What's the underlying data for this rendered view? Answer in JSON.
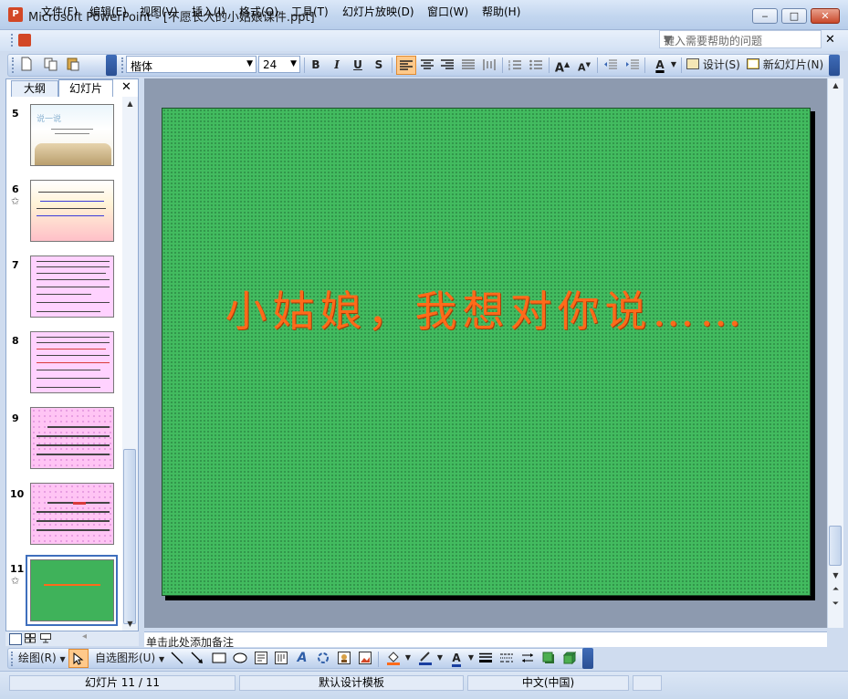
{
  "window": {
    "app_icon_text": "P",
    "title": "Microsoft PowerPoint - [不愿长大的小姑娘课件.ppt]",
    "controls": [
      "‒",
      "□",
      "✕"
    ]
  },
  "menu": {
    "items": [
      "文件(F)",
      "编辑(E)",
      "视图(V)",
      "插入(I)",
      "格式(O)",
      "工具(T)",
      "幻灯片放映(D)",
      "窗口(W)",
      "帮助(H)"
    ],
    "help_placeholder": "键入需要帮助的问题",
    "close_glyph": "✕"
  },
  "toolbar": {
    "font_name": "楷体",
    "font_size": "24",
    "bold": "B",
    "italic": "I",
    "underline": "U",
    "shadow": "S",
    "design_label": "设计(S)",
    "new_slide_label": "新幻灯片(N)",
    "font_color_glyph": "A"
  },
  "left_panel": {
    "tab_outline": "大纲",
    "tab_slides": "幻灯片",
    "close_glyph": "✕",
    "slides": [
      {
        "num": "5",
        "star": ""
      },
      {
        "num": "6",
        "star": "✩"
      },
      {
        "num": "7",
        "star": ""
      },
      {
        "num": "8",
        "star": ""
      },
      {
        "num": "9",
        "star": ""
      },
      {
        "num": "10",
        "star": ""
      },
      {
        "num": "11",
        "star": "✩"
      }
    ],
    "thumb5_title": "说一说"
  },
  "slide": {
    "text": "小姑娘，我想对你说……"
  },
  "notes_placeholder": "单击此处添加备注",
  "drawbar": {
    "draw_label": "绘图(R)",
    "autoshapes_label": "自选图形(U)"
  },
  "status": {
    "slide_position": "幻灯片 11 / 11",
    "template": "默认设计模板",
    "language": "中文(中国)"
  },
  "colors": {
    "slide_background": "#42bb5f",
    "slide_text": "#ff6a1a",
    "selection_border": "#3f6fbd"
  }
}
